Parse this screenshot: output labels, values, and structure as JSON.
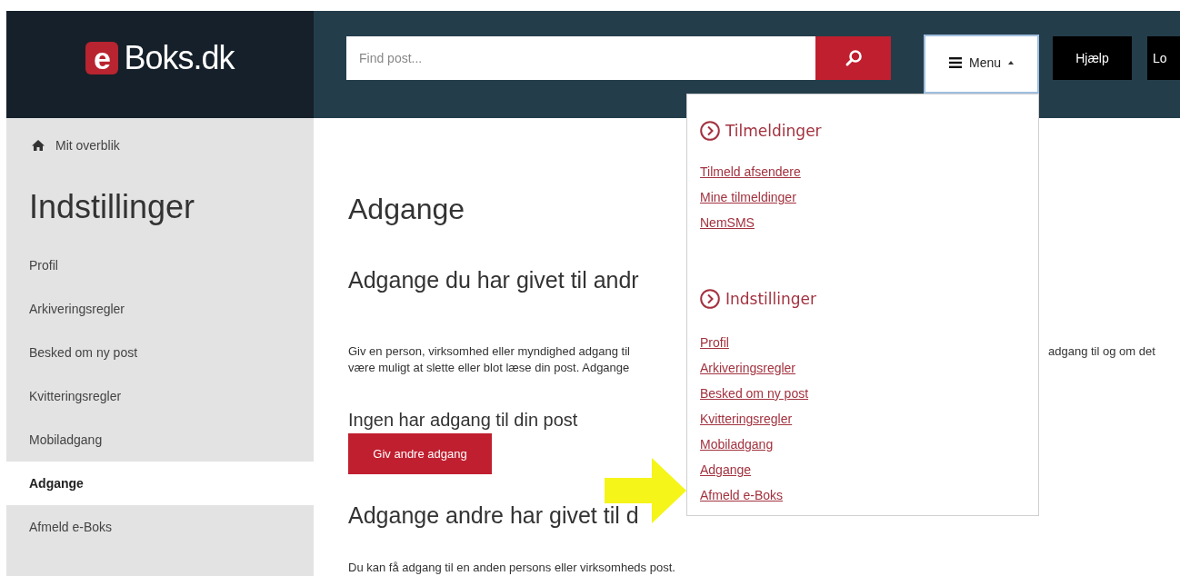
{
  "header": {
    "logo": {
      "badge": "e",
      "text": "Boks.dk"
    },
    "search": {
      "placeholder": "Find post..."
    },
    "menu_button": {
      "label": "Menu",
      "expanded": true
    },
    "buttons": [
      "Hjælp",
      "Lo"
    ]
  },
  "sidebar": {
    "home_link": "Mit overblik",
    "title": "Indstillinger",
    "items": [
      {
        "label": "Profil",
        "selected": false
      },
      {
        "label": "Arkiveringsregler",
        "selected": false
      },
      {
        "label": "Besked om ny post",
        "selected": false
      },
      {
        "label": "Kvitteringsregler",
        "selected": false
      },
      {
        "label": "Mobiladgang",
        "selected": false
      },
      {
        "label": "Adgange",
        "selected": true
      },
      {
        "label": "Afmeld e-Boks",
        "selected": false
      }
    ]
  },
  "main": {
    "title": "Adgange",
    "section_1": {
      "heading": "Adgange du har givet til andr",
      "paragraph_left": "Giv en person, virksomhed eller myndighed adgang til\nvære muligt at slette eller blot læse din post. Adgange",
      "paragraph_right": "adgang til og om det",
      "status": "Ingen har adgang til din post",
      "button": "Giv andre adgang"
    },
    "section_2": {
      "heading": "Adgange andre har givet til d",
      "paragraph": "Du kan få adgang til en anden persons eller virksomheds post."
    }
  },
  "menu_dropdown": {
    "sections": [
      {
        "title": "Tilmeldinger",
        "links": [
          "Tilmeld afsendere",
          "Mine tilmeldinger",
          "NemSMS"
        ]
      },
      {
        "title": "Indstillinger",
        "links": [
          "Profil",
          "Arkiveringsregler",
          "Besked om ny post",
          "Kvitteringsregler",
          "Mobiladgang",
          "Adgange",
          "Afmeld e-Boks"
        ]
      }
    ]
  }
}
